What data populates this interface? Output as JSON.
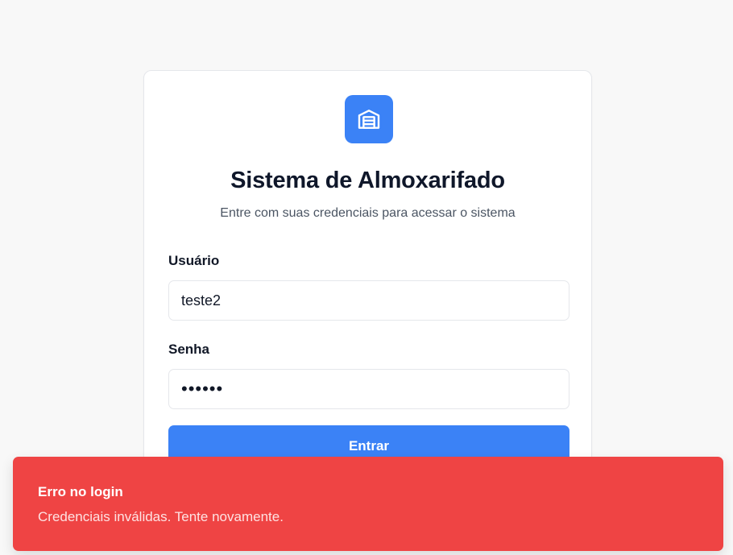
{
  "login": {
    "logo_icon": "warehouse-icon",
    "title": "Sistema de Almoxarifado",
    "subtitle": "Entre com suas credenciais para acessar o sistema",
    "username_label": "Usuário",
    "username_value": "teste2",
    "password_label": "Senha",
    "password_value": "••••••",
    "submit_label": "Entrar"
  },
  "toast": {
    "title": "Erro no login",
    "description": "Credenciais inválidas. Tente novamente."
  },
  "colors": {
    "primary": "#3b82f6",
    "error": "#ef4444",
    "background": "#f8f8f8"
  }
}
